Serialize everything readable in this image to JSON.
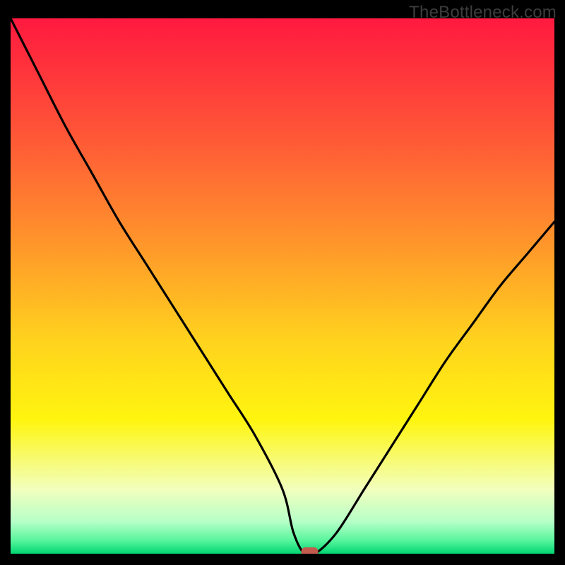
{
  "watermark": "TheBottleneck.com",
  "chart_data": {
    "type": "line",
    "title": "",
    "xlabel": "",
    "ylabel": "",
    "xlim": [
      0,
      100
    ],
    "ylim": [
      0,
      100
    ],
    "grid": false,
    "legend": false,
    "x": [
      0,
      5,
      10,
      15,
      20,
      25,
      30,
      35,
      40,
      45,
      50,
      52,
      54,
      56,
      60,
      65,
      70,
      75,
      80,
      85,
      90,
      95,
      100
    ],
    "values": [
      100,
      90,
      80,
      71,
      62,
      54,
      46,
      38,
      30,
      22,
      12,
      4,
      0,
      0,
      4,
      12,
      20,
      28,
      36,
      43,
      50,
      56,
      62
    ],
    "marker": {
      "x": 55,
      "y": 0
    },
    "gradient_stops": [
      {
        "offset": 0.0,
        "color": "#ff193f"
      },
      {
        "offset": 0.2,
        "color": "#ff5138"
      },
      {
        "offset": 0.4,
        "color": "#ff8f2c"
      },
      {
        "offset": 0.6,
        "color": "#ffd21e"
      },
      {
        "offset": 0.75,
        "color": "#fff50f"
      },
      {
        "offset": 0.88,
        "color": "#f2ffbd"
      },
      {
        "offset": 0.94,
        "color": "#b6ffc8"
      },
      {
        "offset": 0.975,
        "color": "#59f59d"
      },
      {
        "offset": 1.0,
        "color": "#00d672"
      }
    ],
    "marker_color": "#c35b4f",
    "curve_color": "#000000"
  }
}
